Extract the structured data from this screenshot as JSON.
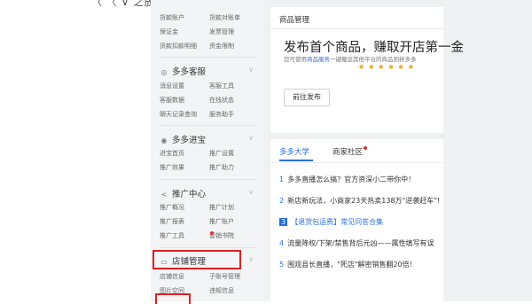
{
  "top_snippet": "〈 〈 ∨ 之放心",
  "sidebar": {
    "account_rows": [
      [
        "货款账户",
        "货款对账单"
      ],
      [
        "保证金",
        "发票管理"
      ],
      [
        "货款扣款明细",
        "资金限制"
      ]
    ],
    "sections": [
      {
        "title": "多多客服",
        "icon": "headset-icon",
        "rows": [
          [
            "消息设置",
            "客服工具"
          ],
          [
            "客服数据",
            "在线状态"
          ],
          [
            "聊天记录查询",
            "服务助手"
          ]
        ]
      },
      {
        "title": "多多进宝",
        "icon": "target-icon",
        "rows": [
          [
            "进宝首页",
            "推广设置"
          ],
          [
            "推广效果",
            "推广助力"
          ]
        ]
      },
      {
        "title": "推广中心",
        "icon": "share-icon",
        "rows": [
          [
            "推广概况",
            "推广计划"
          ],
          [
            "推广报表",
            "推广账户"
          ],
          [
            "推广工具",
            "营销书院"
          ]
        ]
      },
      {
        "title": "店铺管理",
        "icon": "store-icon",
        "rows": [
          [
            "店铺信息",
            "子账号管理"
          ],
          [
            "图片空间",
            "违规信息"
          ]
        ]
      }
    ]
  },
  "goods_card": {
    "header": "商品管理",
    "headline": "发布首个商品，赚取开店第一金",
    "sub_prefix": "您可使用",
    "sub_link": "商品服务",
    "sub_suffix": "一键搬运其他平台的商品到拼多多",
    "button": "前往发布"
  },
  "news_card": {
    "tabs": [
      "多多大学",
      "商家社区"
    ],
    "items": [
      "多多直播怎么搞？官方资深小二带你中！",
      "新店新玩法，小商家23天热卖138万\"逆袭赶车\"!",
      "【退货包运费】常见问答合集",
      "流量降权/下架/禁售背后元凶——属性填写有误",
      "围观县长直播，\"死店\"解密销售翻20倍！"
    ]
  },
  "colors": {
    "accent": "#2a6fdb",
    "highlight_box": "#e02020",
    "sidebar_bg": "#f3f4f6",
    "main_bg": "#f0f1f3"
  }
}
